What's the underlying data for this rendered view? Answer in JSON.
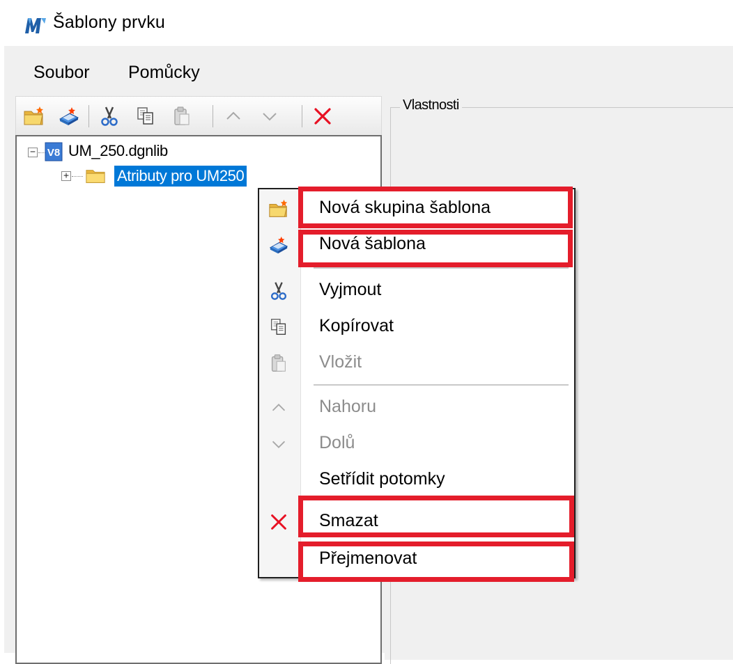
{
  "window": {
    "title": "Šablony prvku"
  },
  "menu": {
    "items": [
      "Soubor",
      "Pomůcky"
    ]
  },
  "toolbar": {
    "buttons": [
      {
        "icon": "new-folder-icon",
        "enabled": true
      },
      {
        "icon": "new-template-icon",
        "enabled": true
      },
      {
        "icon": "cut-icon",
        "enabled": true
      },
      {
        "icon": "copy-icon",
        "enabled": true
      },
      {
        "icon": "paste-icon",
        "enabled": false
      },
      {
        "icon": "chevron-up-icon",
        "enabled": false
      },
      {
        "icon": "chevron-down-icon",
        "enabled": false
      },
      {
        "icon": "delete-icon",
        "enabled": true
      }
    ]
  },
  "tree": {
    "root": {
      "label": "UM_250.dgnlib",
      "icon": "v8-file-icon",
      "badge": "V8",
      "expanded": true
    },
    "child": {
      "label": "Atributy pro UM250",
      "icon": "folder-icon",
      "selected": true,
      "expanded": false
    }
  },
  "properties": {
    "title": "Vlastnosti"
  },
  "context_menu": {
    "items": [
      {
        "label": "Nová skupina šablona",
        "icon": "new-folder-icon",
        "enabled": true,
        "highlighted": true
      },
      {
        "label": "Nová šablona",
        "icon": "new-template-icon",
        "enabled": true,
        "highlighted": true
      },
      {
        "label": "Vyjmout",
        "icon": "cut-icon",
        "enabled": true
      },
      {
        "label": "Kopírovat",
        "icon": "copy-icon",
        "enabled": true
      },
      {
        "label": "Vložit",
        "icon": "paste-icon",
        "enabled": false
      },
      {
        "label": "Nahoru",
        "icon": "chevron-up-icon",
        "enabled": false
      },
      {
        "label": "Dolů",
        "icon": "chevron-down-icon",
        "enabled": false
      },
      {
        "label": "Setřídit potomky",
        "icon": "",
        "enabled": true
      },
      {
        "label": "Smazat",
        "icon": "delete-icon",
        "enabled": true,
        "highlighted": true
      },
      {
        "label": "Přejmenovat",
        "icon": "",
        "enabled": true,
        "highlighted": true
      }
    ]
  },
  "colors": {
    "selection": "#0078d7",
    "highlight_box": "#e41d2b",
    "delete_red": "#e81123",
    "folder_yellow": "#f5c542"
  }
}
